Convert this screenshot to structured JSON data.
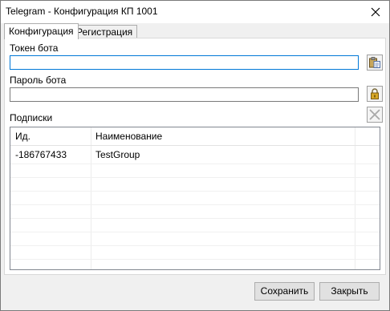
{
  "window": {
    "title": "Telegram - Конфигурация КП 1001"
  },
  "tabs": [
    {
      "label": "Конфигурация",
      "active": true
    },
    {
      "label": "Регистрация",
      "active": false
    }
  ],
  "config": {
    "token_label": "Токен бота",
    "token_value": "",
    "password_label": "Пароль бота",
    "password_value": "",
    "subscriptions_label": "Подписки"
  },
  "grid": {
    "columns": [
      "Ид.",
      "Наименование"
    ],
    "rows": [
      {
        "id": "-186767433",
        "name": "TestGroup"
      }
    ]
  },
  "footer": {
    "save_label": "Сохранить",
    "close_label": "Закрыть"
  },
  "icons": {
    "close": "close-icon",
    "paste": "paste-icon",
    "lock": "lock-icon",
    "delete": "delete-icon"
  },
  "colors": {
    "focus_border": "#0078d7",
    "lock_gold": "#d8a826"
  }
}
